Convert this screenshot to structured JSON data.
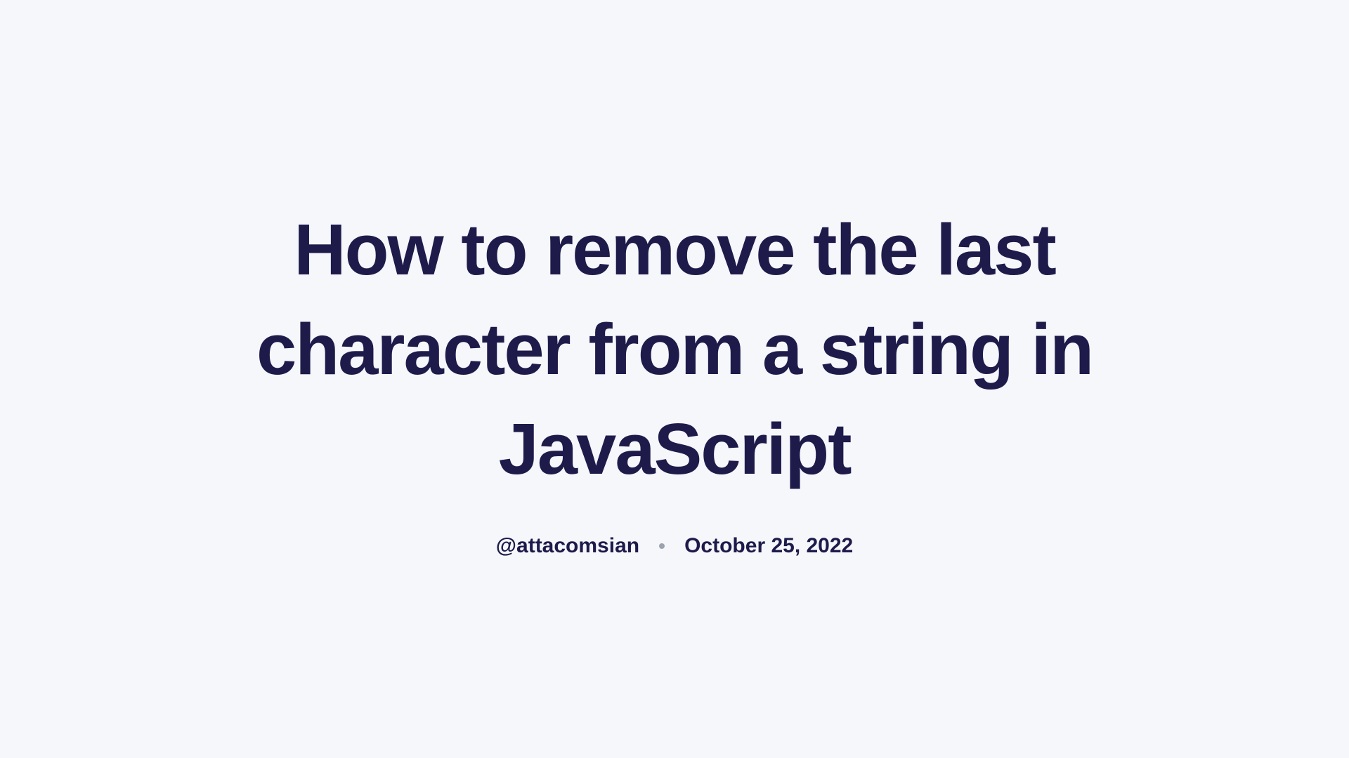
{
  "title": "How to remove the last character from a string in JavaScript",
  "author": "@attacomsian",
  "date": "October 25, 2022"
}
